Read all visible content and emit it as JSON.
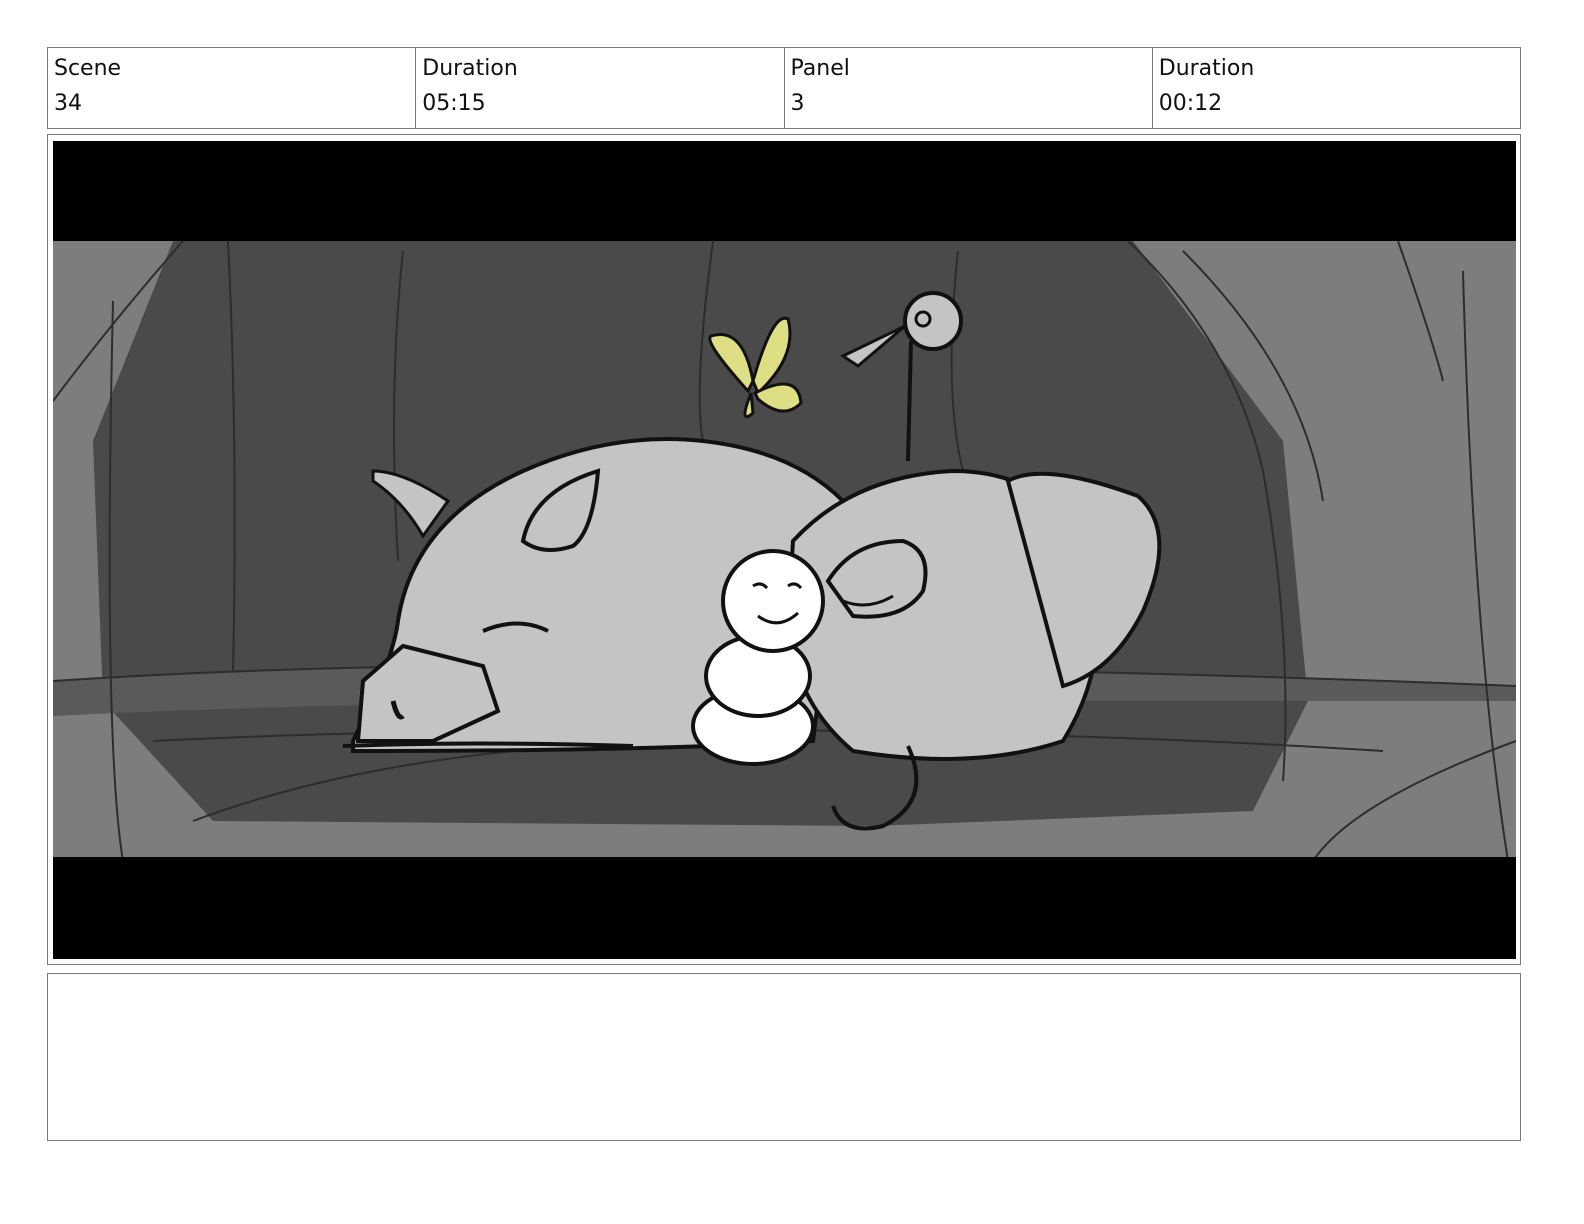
{
  "header": {
    "scene_label": "Scene",
    "scene_value": "34",
    "scene_duration_label": "Duration",
    "scene_duration_value": "05:15",
    "panel_label": "Panel",
    "panel_value": "3",
    "panel_duration_label": "Duration",
    "panel_duration_value": "00:12"
  },
  "notes": {
    "text": ""
  },
  "colors": {
    "letterbox": "#000000",
    "cave_dark": "#4a4a4a",
    "cave_light": "#7d7d7d",
    "creature_fill": "#c4c4c4",
    "butterfly": "#dede84"
  }
}
